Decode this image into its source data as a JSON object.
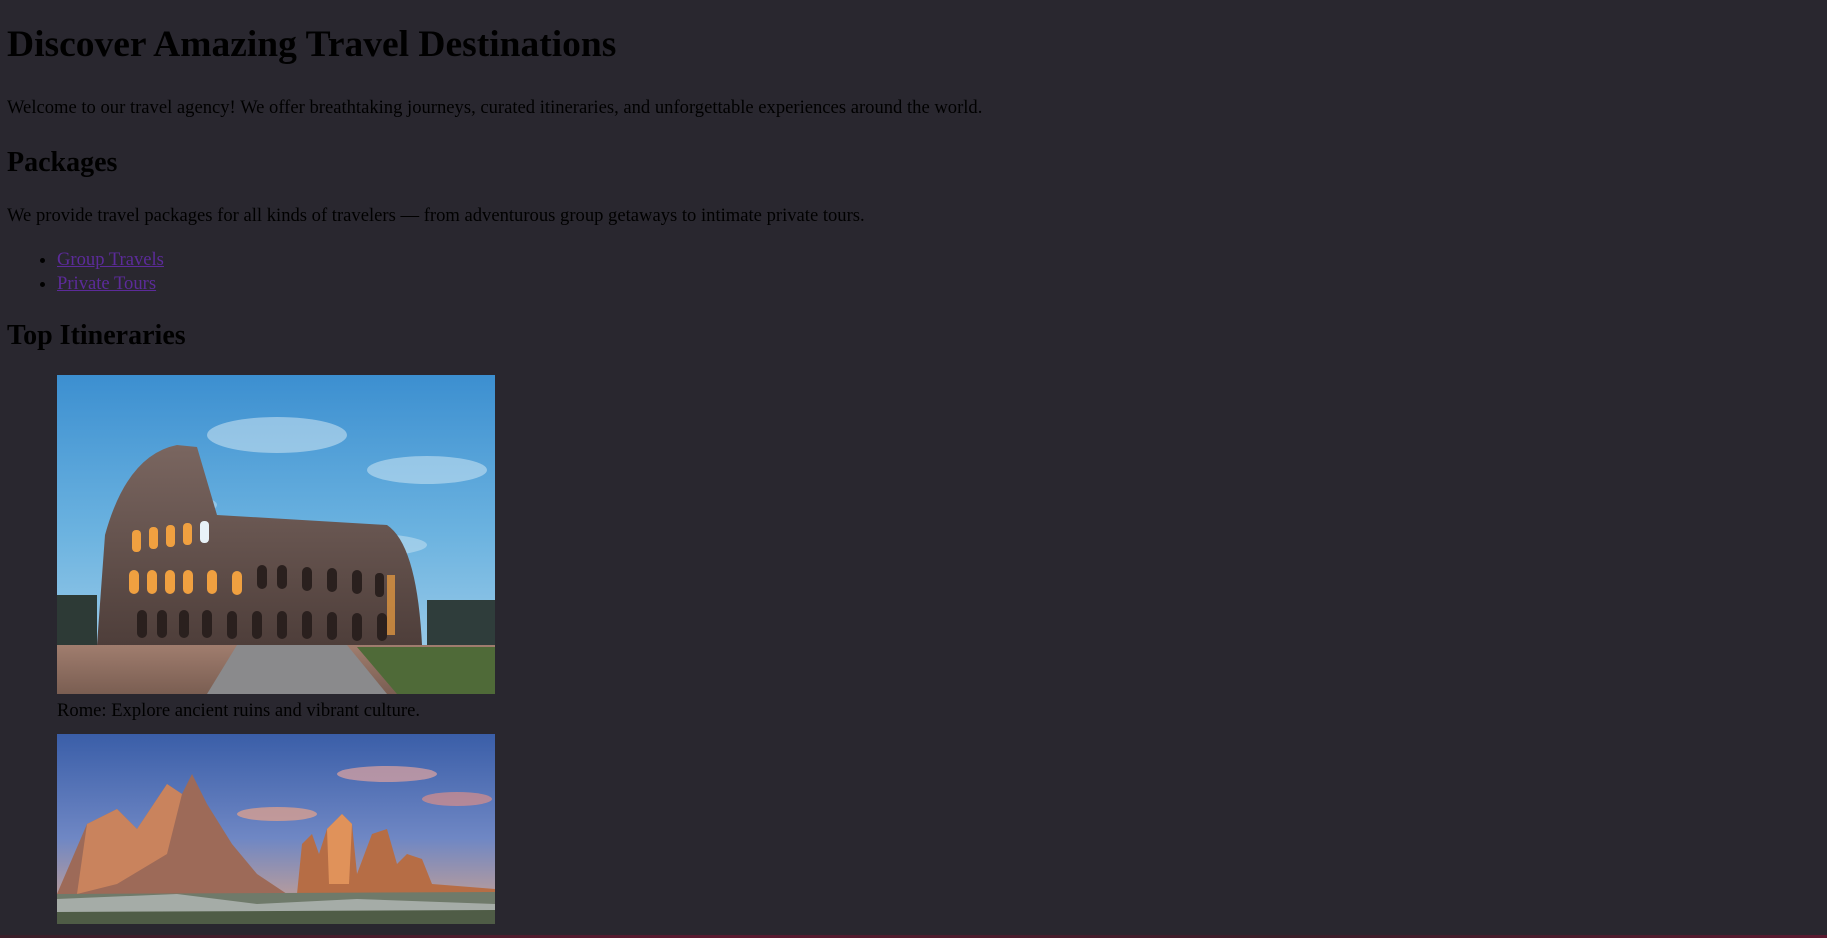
{
  "page": {
    "title": "Discover Amazing Travel Destinations",
    "intro": "Welcome to our travel agency! We offer breathtaking journeys, curated itineraries, and unforgettable experiences around the world."
  },
  "packages": {
    "heading": "Packages",
    "description": "We provide travel packages for all kinds of travelers — from adventurous group getaways to intimate private tours.",
    "links": [
      {
        "label": "Group Travels"
      },
      {
        "label": "Private Tours"
      }
    ]
  },
  "itineraries": {
    "heading": "Top Itineraries",
    "items": [
      {
        "caption": "Rome: Explore ancient ruins and vibrant culture.",
        "image": "colosseum-photo"
      },
      {
        "caption": "",
        "image": "dolomites-photo"
      }
    ]
  },
  "colors": {
    "background": "#29272f",
    "link": "#5c2b9a"
  }
}
